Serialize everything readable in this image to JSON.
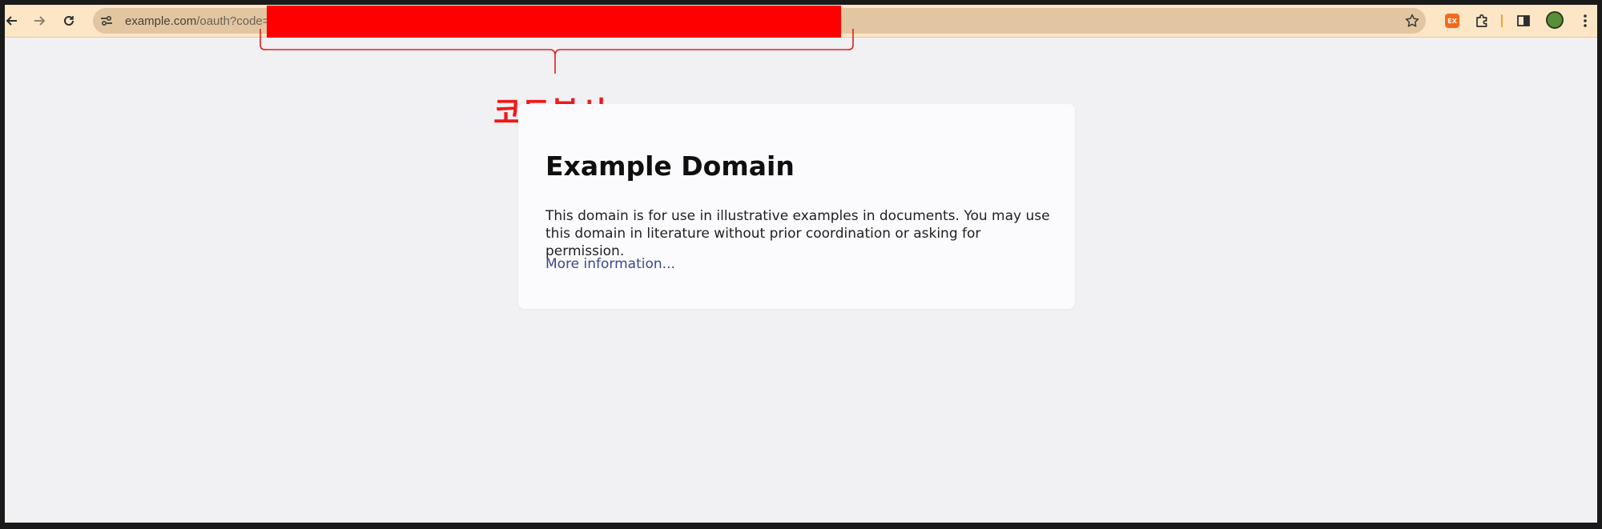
{
  "browser": {
    "url_visible": "example.com/oauth?code=",
    "url_host": "example.com",
    "url_path": "/oauth?code=",
    "icons": {
      "back": "back-arrow-icon",
      "forward": "forward-arrow-icon",
      "reload": "reload-icon",
      "site_info": "site-settings-icon",
      "bookmark": "star-icon",
      "extension_badge": "extension-badge-icon",
      "extensions": "puzzle-icon",
      "side_panel": "side-panel-icon",
      "profile": "profile-avatar",
      "menu": "kebab-menu-icon"
    },
    "extension_badge_text": "EX",
    "colors": {
      "toolbar": "#fde6c6",
      "omnibox": "#e2c6a1",
      "redaction": "#ff0000"
    }
  },
  "annotation": {
    "label": "코드복사",
    "color": "#ef1a1a"
  },
  "page": {
    "title": "Example Domain",
    "body": "This domain is for use in illustrative examples in documents. You may use this domain in literature without prior coordination or asking for permission.",
    "link": "More information..."
  }
}
